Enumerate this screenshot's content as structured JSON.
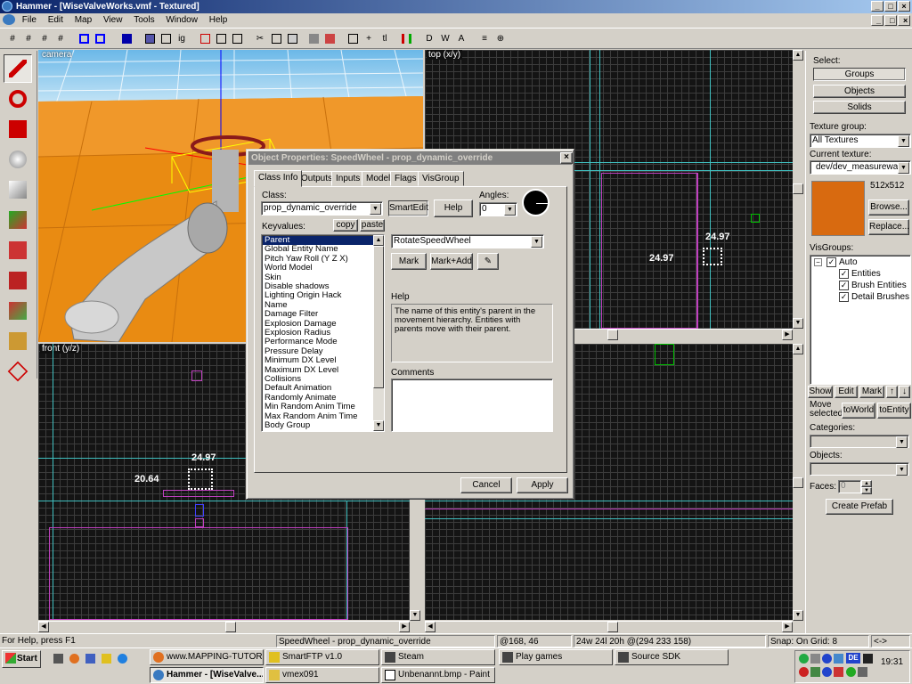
{
  "window": {
    "title": "Hammer - [WiseValveWorks.vmf - Textured]"
  },
  "menu": [
    "File",
    "Edit",
    "Map",
    "View",
    "Tools",
    "Window",
    "Help"
  ],
  "views": {
    "camera": "camera",
    "top": "top (x/y)",
    "front": "front (y/z)"
  },
  "measurements": {
    "top_label": "24.97",
    "top_side": "24.97",
    "front_label": "24.97",
    "front_side": "20.64"
  },
  "dialog": {
    "title": "Object Properties: SpeedWheel - prop_dynamic_override",
    "tabs": [
      "Class Info",
      "Outputs",
      "Inputs",
      "Model",
      "Flags",
      "VisGroup"
    ],
    "class_label": "Class:",
    "class_value": "prop_dynamic_override",
    "smartedit": "SmartEdit",
    "help_button": "Help",
    "angles_label": "Angles:",
    "angles_value": "0",
    "keyvalues_label": "Keyvalues:",
    "copy": "copy",
    "paste": "paste",
    "keyvalues": [
      "Parent",
      "Global Entity Name",
      "Pitch Yaw Roll (Y Z X)",
      "World Model",
      "Skin",
      "Disable shadows",
      "Lighting Origin Hack",
      "Name",
      "Damage Filter",
      "Explosion Damage",
      "Explosion Radius",
      "Performance Mode",
      "Pressure Delay",
      "Minimum DX Level",
      "Maximum DX Level",
      "Collisions",
      "Default Animation",
      "Randomly Animate",
      "Min Random Anim Time",
      "Max Random Anim Time",
      "Body Group"
    ],
    "value_field": "RotateSpeedWheel",
    "mark": "Mark",
    "mark_add": "Mark+Add",
    "help_label": "Help",
    "help_text": "The name of this entity's parent in the movement hierarchy. Entities with parents move with their parent.",
    "comments_label": "Comments",
    "cancel": "Cancel",
    "apply": "Apply"
  },
  "right_panel": {
    "select_label": "Select:",
    "groups": "Groups",
    "objects": "Objects",
    "solids": "Solids",
    "texture_group_label": "Texture group:",
    "texture_group": "All Textures",
    "current_texture_label": "Current texture:",
    "current_texture": "dev/dev_measurewall0",
    "texture_size": "512x512",
    "browse": "Browse...",
    "replace": "Replace...",
    "visgroups_label": "VisGroups:",
    "visgroups": [
      "Auto",
      "Entities",
      "Brush Entities",
      "Detail Brushes"
    ],
    "show": "Show",
    "edit": "Edit",
    "mark": "Mark",
    "move_selected": "Move selected:",
    "to_world": "toWorld",
    "to_entity": "toEntity",
    "categories_label": "Categories:",
    "objects_label": "Objects:",
    "faces_label": "Faces:",
    "faces_value": "0",
    "create_prefab": "Create Prefab"
  },
  "status": {
    "help": "For Help, press F1",
    "selection": "SpeedWheel - prop_dynamic_override",
    "coords": "@168, 46",
    "size": "24w 24l 20h @(294 233 158)",
    "snap": "Snap: On Grid: 8",
    "arrows": "<->"
  },
  "taskbar": {
    "start": "Start",
    "tasks_row1": [
      "www.MAPPING-TUTORIA...",
      "SmartFTP v1.0",
      "Steam",
      "Play games",
      "Source SDK"
    ],
    "tasks_row2": [
      "Hammer - [WiseValve...",
      "vmex091",
      "Unbenannt.bmp - Paint"
    ],
    "lang": "DE",
    "clock": "19:31"
  },
  "colors": {
    "magenta": "#c040c0",
    "cyan": "#40c0c0",
    "titlebar": "#0a246a",
    "texture": "#d86a10"
  }
}
